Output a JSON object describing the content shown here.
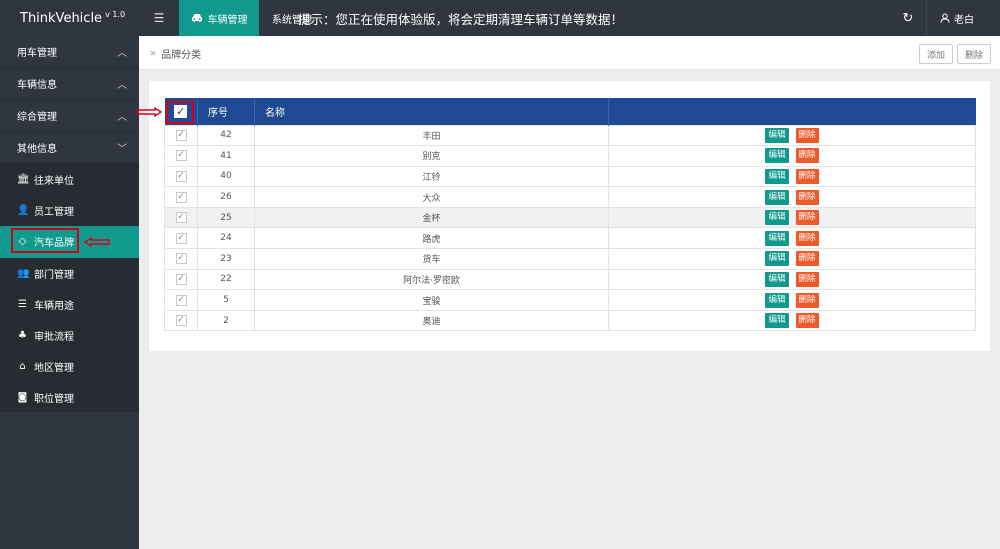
{
  "app": {
    "brand": "ThinkVehicle",
    "version": "v 1.0",
    "menu_icon": "hamburger-icon",
    "active_tab": {
      "label": "车辆管理",
      "icon": "car-icon"
    },
    "tab2": "系统管理",
    "notice": "提示：您正在使用体验版，将会定期清理车辆订单等数据！",
    "user": "老白"
  },
  "sidebar": {
    "groups": [
      {
        "label": "用车管理",
        "expanded": true
      },
      {
        "label": "车辆信息",
        "expanded": true
      },
      {
        "label": "综合管理",
        "expanded": true
      },
      {
        "label": "其他信息",
        "expanded": false
      }
    ],
    "items": [
      {
        "label": "往来单位",
        "icon": "bank-icon"
      },
      {
        "label": "员工管理",
        "icon": "user-icon"
      },
      {
        "label": "汽车品牌",
        "icon": "diamond-icon",
        "active": true
      },
      {
        "label": "部门管理",
        "icon": "users-icon"
      },
      {
        "label": "车辆用途",
        "icon": "list-icon"
      },
      {
        "label": "审批流程",
        "icon": "flow-icon"
      },
      {
        "label": "地区管理",
        "icon": "home-icon"
      },
      {
        "label": "职位管理",
        "icon": "camera-icon"
      }
    ]
  },
  "breadcrumb": "品牌分类",
  "toolbar": {
    "add": "添加",
    "delete": "删除"
  },
  "table": {
    "headers": {
      "seq": "序号",
      "name": "名称",
      "ops": ""
    },
    "rows": [
      {
        "seq": "42",
        "name": "丰田"
      },
      {
        "seq": "41",
        "name": "别克"
      },
      {
        "seq": "40",
        "name": "江铃"
      },
      {
        "seq": "26",
        "name": "大众"
      },
      {
        "seq": "25",
        "name": "金杯",
        "highlighted": true
      },
      {
        "seq": "24",
        "name": "路虎"
      },
      {
        "seq": "23",
        "name": "货车"
      },
      {
        "seq": "22",
        "name": "阿尔法·罗密欧"
      },
      {
        "seq": "5",
        "name": "宝骏"
      },
      {
        "seq": "2",
        "name": "奥迪"
      }
    ],
    "edit_label": "编辑",
    "delete_label": "删除"
  },
  "colors": {
    "topbar": "#2f3640",
    "accent": "#12998e",
    "table_head": "#204a93",
    "danger": "#ef5a2a",
    "highlight": "#d0021b"
  }
}
